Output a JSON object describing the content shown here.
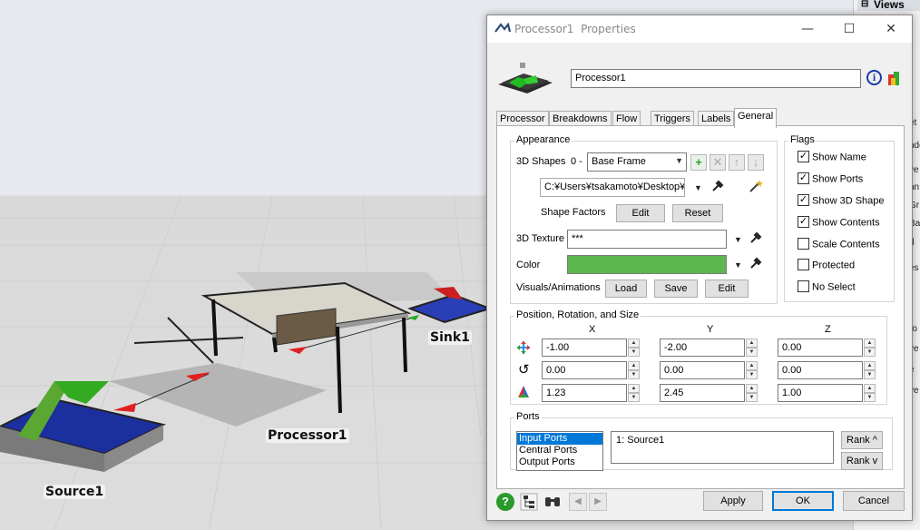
{
  "scene": {
    "labels": {
      "source": "Source1",
      "processor": "Processor1",
      "sink": "Sink1"
    }
  },
  "views_panel": {
    "title": "Views",
    "edge_fragments": [
      "et",
      "nde",
      "ve",
      "nn",
      "Gr",
      "Ba",
      "d",
      "es",
      "ro",
      "ve",
      "e",
      "ve"
    ]
  },
  "dialog": {
    "title_object": "Processor1",
    "title_suffix": "Properties",
    "minimize": "—",
    "maximize": "☐",
    "close": "✕",
    "name_value": "Processor1",
    "tabs": [
      "Processor",
      "Breakdowns",
      "Flow",
      "Triggers",
      "Labels",
      "General"
    ],
    "active_tab": "General",
    "appearance": {
      "title": "Appearance",
      "shapes_label": "3D Shapes",
      "shapes_index": "0 -",
      "shapes_value": "Base Frame",
      "path_value": "C:¥Users¥tsakamoto¥Desktop¥",
      "shape_factors_label": "Shape Factors",
      "edit_label": "Edit",
      "reset_label": "Reset",
      "texture_label": "3D Texture",
      "texture_value": "***",
      "color_label": "Color",
      "color_value": "#5cb84e",
      "visuals_label": "Visuals/Animations",
      "load_label": "Load",
      "save_label": "Save",
      "edit2_label": "Edit"
    },
    "flags": {
      "title": "Flags",
      "items": [
        {
          "label": "Show Name",
          "checked": true
        },
        {
          "label": "Show Ports",
          "checked": true
        },
        {
          "label": "Show 3D Shape",
          "checked": true
        },
        {
          "label": "Show Contents",
          "checked": true
        },
        {
          "label": "Scale Contents",
          "checked": false
        },
        {
          "label": "Protected",
          "checked": false
        },
        {
          "label": "No Select",
          "checked": false
        }
      ]
    },
    "prs": {
      "title": "Position, Rotation, and Size",
      "col_x": "X",
      "col_y": "Y",
      "col_z": "Z",
      "position": [
        "-1.00",
        "-2.00",
        "0.00"
      ],
      "rotation": [
        "0.00",
        "0.00",
        "0.00"
      ],
      "size": [
        "1.23",
        "2.45",
        "1.00"
      ]
    },
    "ports": {
      "title": "Ports",
      "types": [
        "Input Ports",
        "Central Ports",
        "Output Ports"
      ],
      "selected_type": "Input Ports",
      "connections": [
        "1:  Source1"
      ],
      "rank_up": "Rank ^",
      "rank_down": "Rank v"
    },
    "footer": {
      "apply": "Apply",
      "ok": "OK",
      "cancel": "Cancel"
    }
  }
}
